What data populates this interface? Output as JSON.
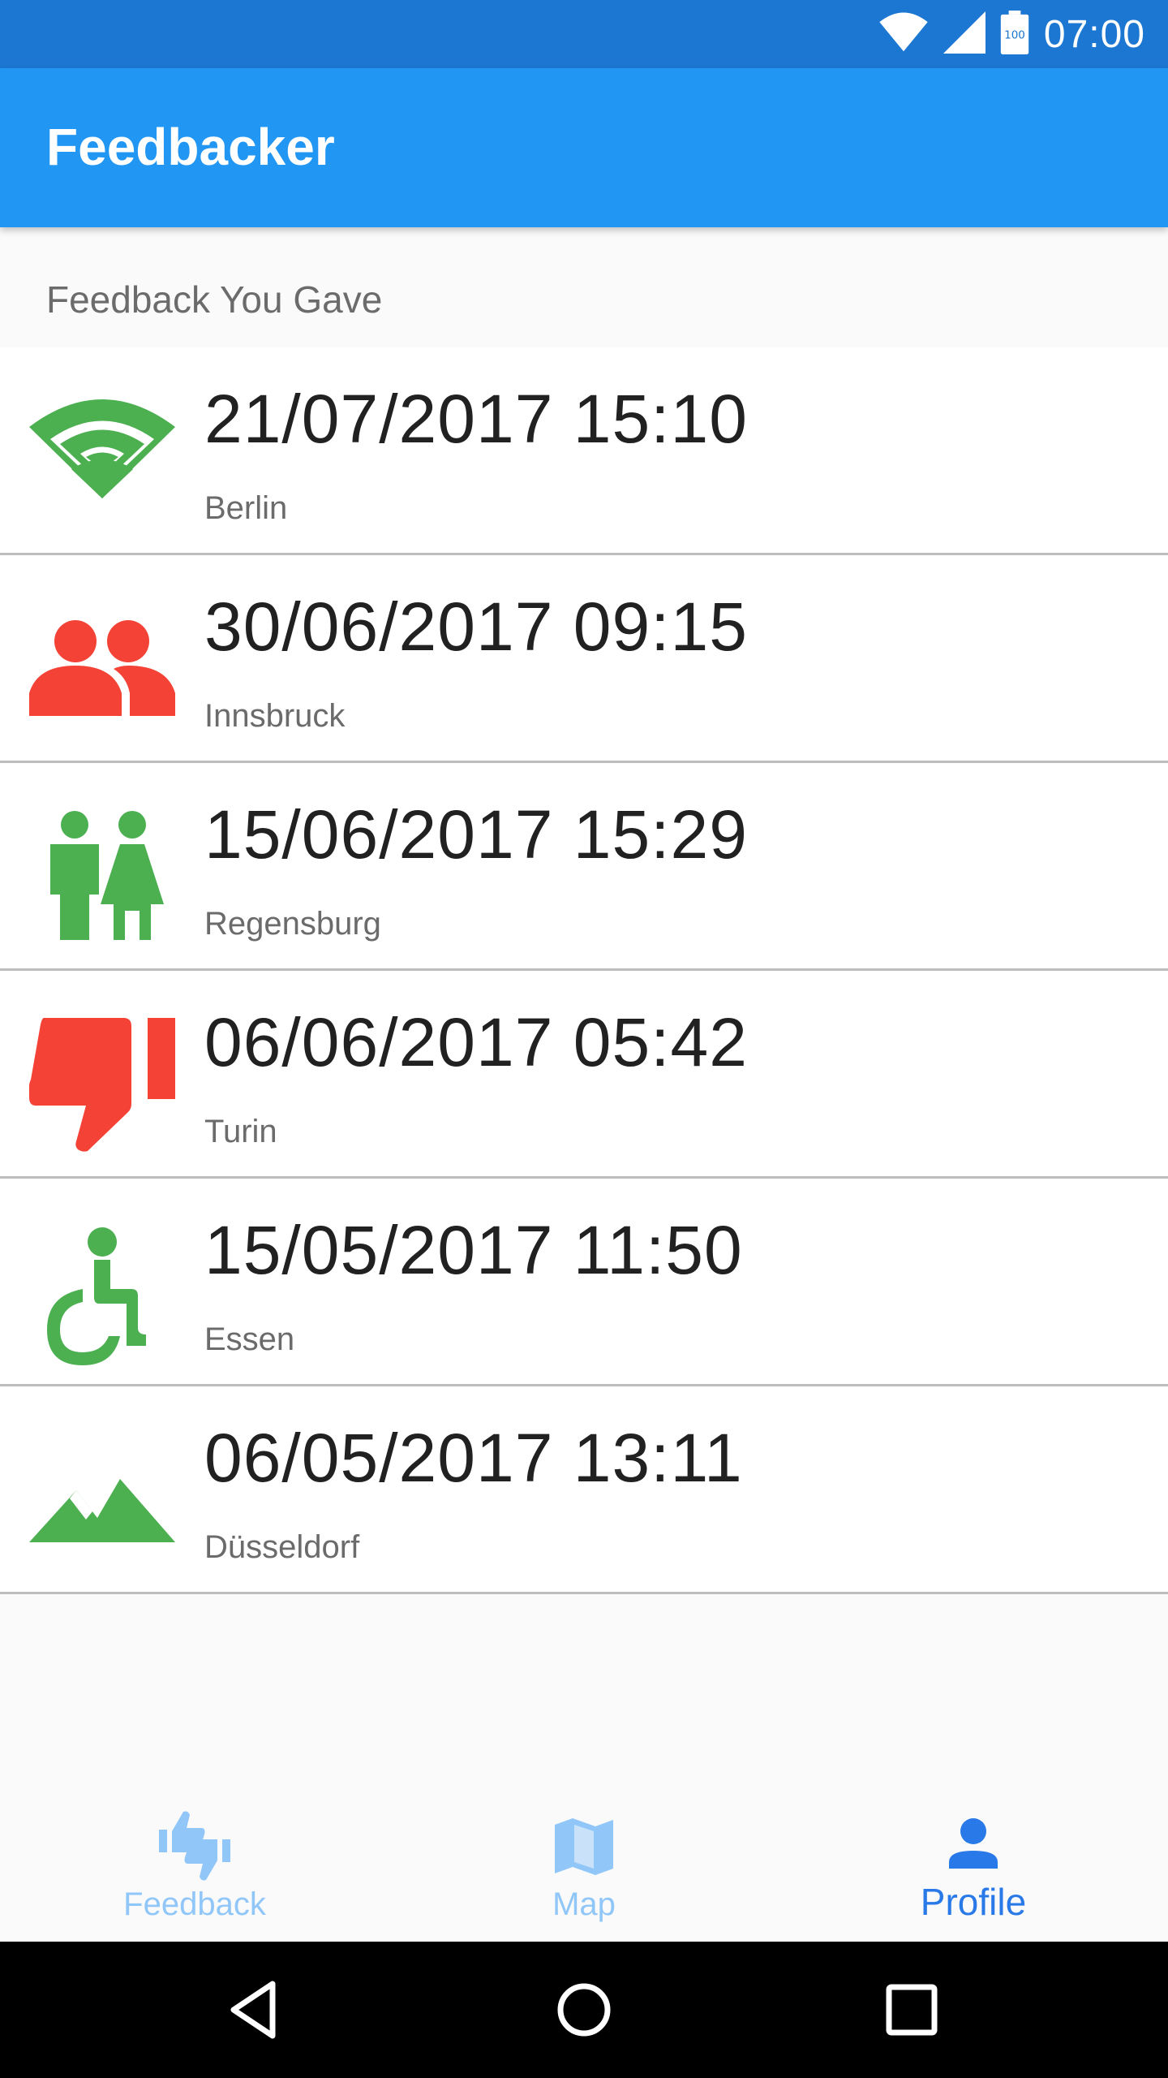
{
  "status_bar": {
    "time": "07:00",
    "battery_level": "100",
    "icons": [
      "wifi-icon",
      "signal-icon",
      "battery-icon"
    ]
  },
  "app_bar": {
    "title": "Feedbacker"
  },
  "section": {
    "header": "Feedback You Gave"
  },
  "feedback_items": [
    {
      "date": "21/07/2017 15:10",
      "city": "Berlin",
      "icon": "wifi-icon",
      "color": "#4caf50"
    },
    {
      "date": "30/06/2017 09:15",
      "city": "Innsbruck",
      "icon": "people-icon",
      "color": "#f44336"
    },
    {
      "date": "15/06/2017 15:29",
      "city": "Regensburg",
      "icon": "restroom-icon",
      "color": "#4caf50"
    },
    {
      "date": "06/06/2017 05:42",
      "city": "Turin",
      "icon": "thumb-down-icon",
      "color": "#f44336"
    },
    {
      "date": "15/05/2017 11:50",
      "city": "Essen",
      "icon": "accessible-icon",
      "color": "#4caf50"
    },
    {
      "date": "06/05/2017 13:11",
      "city": "Düsseldorf",
      "icon": "landscape-icon",
      "color": "#4caf50"
    }
  ],
  "bottom_nav": {
    "items": [
      {
        "label": "Feedback",
        "icon": "thumbs-icon",
        "active": false
      },
      {
        "label": "Map",
        "icon": "map-icon",
        "active": false
      },
      {
        "label": "Profile",
        "icon": "person-icon",
        "active": true
      }
    ]
  },
  "colors": {
    "status_bar": "#1c77d2",
    "app_bar": "#2196f3",
    "positive": "#4caf50",
    "negative": "#f44336",
    "nav_active": "#2979e8",
    "nav_inactive": "#90c6f8"
  },
  "system_nav": {
    "buttons": [
      "back-icon",
      "home-icon",
      "recents-icon"
    ]
  }
}
